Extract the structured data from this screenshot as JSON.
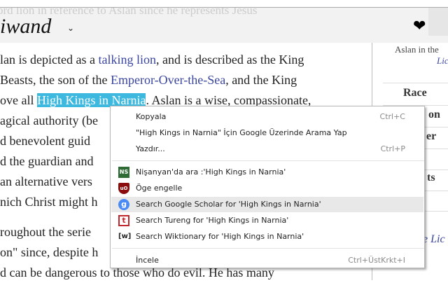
{
  "header": {
    "faded_text": "ord lion in reference to Aslan since he represents Jesus",
    "logo": "iwand",
    "chevron": "⌄"
  },
  "article": {
    "lines": [
      {
        "pre": "lan is depicted as a ",
        "link": "talking lion",
        "post": ", and is described as the King"
      },
      {
        "pre": " Beasts, the son of the ",
        "link": "Emperor-Over-the-Sea",
        "post": ", and the King"
      },
      {
        "pre": "ove all ",
        "selected": "High Kings in Narnia",
        "post": ". Aslan is a wise, compassionate,"
      },
      {
        "text": "agical authority (be"
      },
      {
        "text": "d benevolent guid"
      },
      {
        "text": "d the guardian and"
      },
      {
        "text": " an alternative vers"
      },
      {
        "text": "nich Christ might h"
      },
      {
        "text": "roughout the serie"
      },
      {
        "text": "on\" since, despite h"
      },
      {
        "text": "d can be dangerous to those who do evil. He has many"
      }
    ]
  },
  "sidebar": {
    "caption": "Aslan in the",
    "caption_link": "Lic",
    "rows": [
      "Race",
      "on",
      "er",
      "ts"
    ],
    "link2": "e Lic"
  },
  "context_menu": {
    "items": [
      {
        "label": "Kopyala",
        "shortcut": "Ctrl+C"
      },
      {
        "label": "\"High Kings in Narnia\" İçin Google Üzerinde Arama Yap"
      },
      {
        "label": "Yazdır...",
        "shortcut": "Ctrl+P"
      },
      {
        "label": "Nişanyan'da ara :'High Kings in Narnia'",
        "icon": "nisanyan-icon",
        "icon_text": "NS"
      },
      {
        "label": "Öge engelle",
        "icon": "ublock-icon",
        "icon_text": "uO"
      },
      {
        "label": "Search Google Scholar for 'High Kings in Narnia'",
        "icon": "google-scholar-icon",
        "icon_text": "g"
      },
      {
        "label": "Search Tureng for 'High Kings in Narnia'",
        "icon": "tureng-icon",
        "icon_text": "t"
      },
      {
        "label": "Search Wiktionary for 'High Kings in Narnia'",
        "icon": "wiktionary-icon",
        "icon_text": "[w]"
      },
      {
        "label": "İncele",
        "shortcut": "Ctrl+ÜstKrkt+I"
      }
    ]
  },
  "colors": {
    "selection": "#3db8df",
    "link": "#3a45a0",
    "menu_highlight": "#e8e8e8"
  }
}
